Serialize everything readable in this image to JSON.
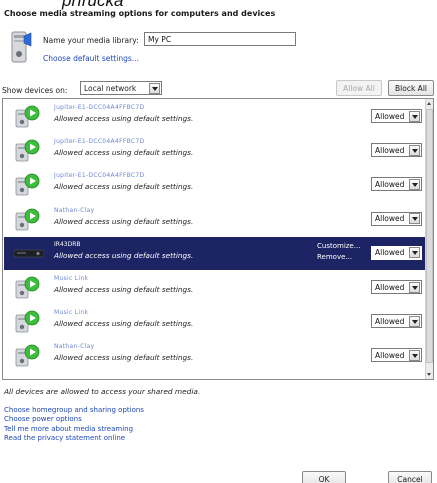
{
  "overlay_caption": "příručka",
  "page": {
    "title": "Choose media streaming options for computers and devices"
  },
  "library": {
    "name_label": "Name your media library:",
    "name_value": "My PC",
    "default_settings_link": "Choose default settings..."
  },
  "filter": {
    "show_devices_label": "Show devices on:",
    "show_devices_value": "Local network",
    "allow_all_label": "Allow All",
    "block_all_label": "Block All"
  },
  "devices": [
    {
      "name": "Jupiter-E1-DCC04A4FFBC7D",
      "status": "Allowed access using default settings.",
      "access": "Allowed",
      "selected": false
    },
    {
      "name": "Jupiter-E1-DCC04A4FFBC7D",
      "status": "Allowed access using default settings.",
      "access": "Allowed",
      "selected": false
    },
    {
      "name": "Jupiter-E1-DCC04A4FFBC7D",
      "status": "Allowed access using default settings.",
      "access": "Allowed",
      "selected": false
    },
    {
      "name": "Nathan-Clay",
      "status": "Allowed access using default settings.",
      "access": "Allowed",
      "selected": false
    },
    {
      "name": "IR43DRB",
      "status": "Allowed access using default settings.",
      "access": "Allowed",
      "selected": true,
      "links": [
        "Customize...",
        "Remove..."
      ]
    },
    {
      "name": "Music Link",
      "status": "Allowed access using default settings.",
      "access": "Allowed",
      "selected": false
    },
    {
      "name": "Music Link",
      "status": "Allowed access using default settings.",
      "access": "Allowed",
      "selected": false
    },
    {
      "name": "Nathan-Clay",
      "status": "Allowed access using default settings.",
      "access": "Allowed",
      "selected": false
    }
  ],
  "summary": "All devices are allowed to access your shared media.",
  "links": [
    "Choose homegroup and sharing options",
    "Choose power options",
    "Tell me more about media streaming",
    "Read the privacy statement online"
  ],
  "buttons": {
    "ok": "OK",
    "cancel": "Cancel"
  },
  "colors": {
    "selection": "#1c2464",
    "link": "#1f48b8",
    "accent_green": "#3cbd3c"
  },
  "icons": {
    "library": "media-library-icon",
    "device_pc": "media-player-device-icon",
    "device_receiver": "av-receiver-icon"
  }
}
